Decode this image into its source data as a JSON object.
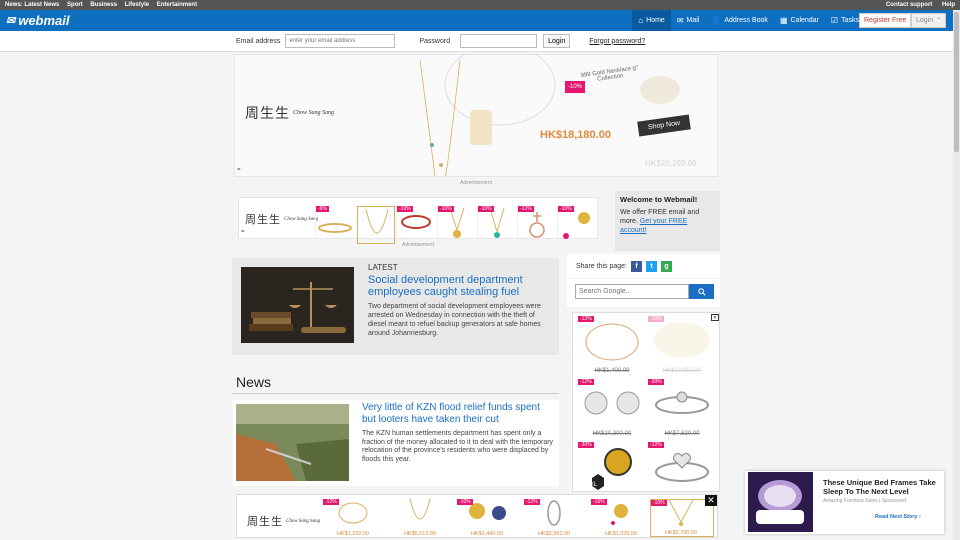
{
  "topbar": {
    "links": [
      "News: Latest News",
      "Sport",
      "Business",
      "Lifestyle",
      "Entertainment"
    ],
    "right": [
      "Contact support",
      "Help"
    ]
  },
  "header": {
    "logo": "webmail",
    "nav": [
      "Home",
      "Mail",
      "Address Book",
      "Calendar",
      "Tasks"
    ],
    "register": "Register Free",
    "login": "Login"
  },
  "login_strip": {
    "email_label": "Email address",
    "email_placeholder": "enter your email address",
    "password_label": "Password",
    "button": "Login",
    "forgot": "Forgot password?"
  },
  "banner_ad": {
    "brand_cn": "周生生",
    "brand_en": "Chow Sang Sang",
    "discount": "-10%",
    "caption": "999 Gold Necklace g° Collection",
    "price": "HK$18,180.00",
    "old_price": "HK$20,200.00",
    "cta": "Shop Now",
    "label": "Advertisement"
  },
  "strip_ad": {
    "discounts": [
      "-9%",
      "",
      "-10%",
      "-10%",
      "-10%",
      "-12%",
      "-10%"
    ],
    "label": "Advertisement"
  },
  "welcome": {
    "title": "Welcome to Webmail!",
    "body": "We offer FREE email and more.",
    "link": "Get your FREE account!"
  },
  "latest": {
    "kicker": "LATEST",
    "title": "Social development department employees caught stealing fuel",
    "summary": "Two department of social development employees were arrested on Wednesday in connection with the theft of diesel meant to refuel backup generators at safe homes around Johannesburg."
  },
  "news": {
    "heading": "News",
    "story_title": "Very little of KZN flood relief funds spent but looters have taken their cut",
    "story_summary": "The KZN human settlements department has spent only a fraction of the money allocated to it to deal with the temporary relocation of the province’s residents who were displaced by floods this year."
  },
  "share": {
    "label": "Share this page:",
    "icons": [
      "f",
      "t",
      "g"
    ]
  },
  "search": {
    "placeholder": "Search Google..."
  },
  "side_ad": {
    "items": [
      {
        "disc": "-12%",
        "price": "HK$1,400.00"
      },
      {
        "disc": "-10%",
        "price": "HK$13,050.00"
      },
      {
        "disc": "-12%",
        "price": "HK$10,300.00"
      },
      {
        "disc": "-30%",
        "price": "HK$7,620.00"
      },
      {
        "disc": "-30%",
        "price": ""
      },
      {
        "disc": "-12%",
        "price": ""
      }
    ],
    "badge": "XL"
  },
  "bottom_ad": {
    "items": [
      {
        "disc": "-12%",
        "price": "HK$1,232.00"
      },
      {
        "disc": "",
        "price": "HK$5,512.00"
      },
      {
        "disc": "-10%",
        "price": "HK$1,440.00"
      },
      {
        "disc": "-12%",
        "price": "HK$2,992.00"
      },
      {
        "disc": "-10%",
        "price": "HK$1,035.00"
      },
      {
        "disc": "-10%",
        "price": "HK$2,790.00"
      }
    ],
    "close": "✕"
  },
  "promo": {
    "title": "These Unique Bed Frames Take Sleep To The Next Level",
    "source": "Amazing Furniture Sales | Sponsored",
    "next": "Read Next Story ›"
  },
  "colors": {
    "header_blue": "#0e6fc1",
    "link_blue": "#1a6fc4",
    "discount_pink": "#e6156e",
    "price_gold": "#e08a3c"
  }
}
